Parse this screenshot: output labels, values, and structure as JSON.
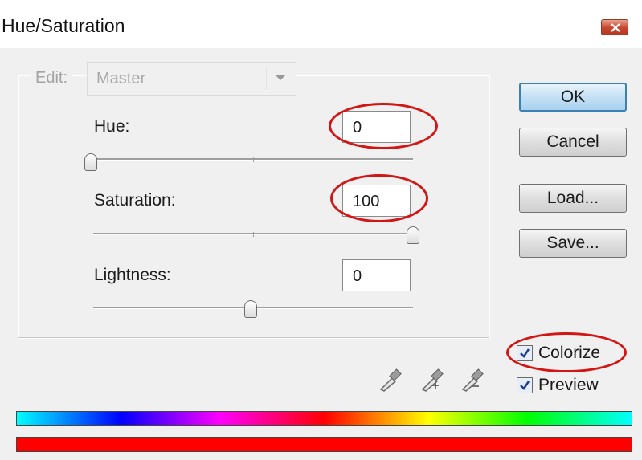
{
  "window": {
    "title": "Hue/Saturation"
  },
  "edit": {
    "label": "Edit:",
    "value": "Master"
  },
  "hue": {
    "label": "Hue:",
    "value": "0",
    "level": 0
  },
  "saturation": {
    "label": "Saturation:",
    "value": "100",
    "level": 1.0
  },
  "lightness": {
    "label": "Lightness:",
    "value": "0",
    "level": 0.5
  },
  "buttons": {
    "ok": "OK",
    "cancel": "Cancel",
    "load": "Load...",
    "save": "Save..."
  },
  "colorize": {
    "label": "Colorize",
    "checked": true
  },
  "preview": {
    "label": "Preview",
    "checked": true
  },
  "colors": {
    "highlight": "#d21515",
    "result_bar": "#ff0000"
  }
}
